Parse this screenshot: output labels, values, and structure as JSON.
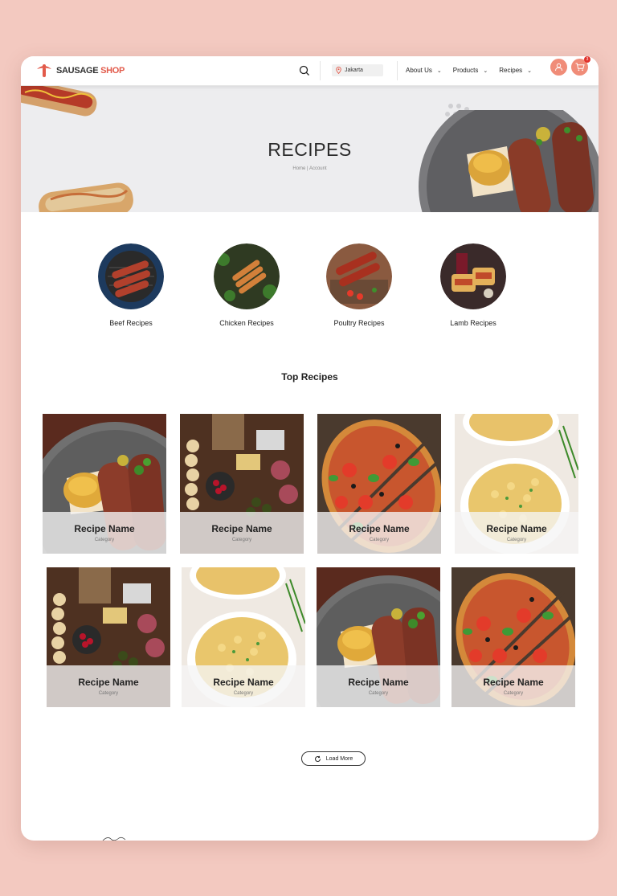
{
  "brand": {
    "name_part1": "SAUSAGE",
    "name_part2": "SHOP"
  },
  "header": {
    "location": "Jakarta",
    "nav": [
      {
        "label": "About Us"
      },
      {
        "label": "Products"
      },
      {
        "label": "Recipes"
      }
    ],
    "cart_count": "3"
  },
  "hero": {
    "title": "RECIPES",
    "breadcrumb": "Home | Account"
  },
  "categories": [
    {
      "label": "Beef Recipes"
    },
    {
      "label": "Chicken Recipes"
    },
    {
      "label": "Poultry Recipes"
    },
    {
      "label": "Lamb Recipes"
    }
  ],
  "section_title": "Top Recipes",
  "recipes": [
    {
      "name": "Recipe Name",
      "category": "Category"
    },
    {
      "name": "Recipe Name",
      "category": "Category"
    },
    {
      "name": "Recipe Name",
      "category": "Category"
    },
    {
      "name": "Recipe Name",
      "category": "Category"
    },
    {
      "name": "Recipe Name",
      "category": "Category"
    },
    {
      "name": "Recipe Name",
      "category": "Category"
    },
    {
      "name": "Recipe Name",
      "category": "Category"
    },
    {
      "name": "Recipe Name",
      "category": "Category"
    }
  ],
  "load_more": "Load More",
  "colors": {
    "accent": "#f08c78",
    "background": "#f3c9c0",
    "badge": "#e0312b"
  },
  "icons": [
    "search-icon",
    "location-pin-icon",
    "chevron-down-icon",
    "user-icon",
    "cart-icon",
    "refresh-icon"
  ]
}
